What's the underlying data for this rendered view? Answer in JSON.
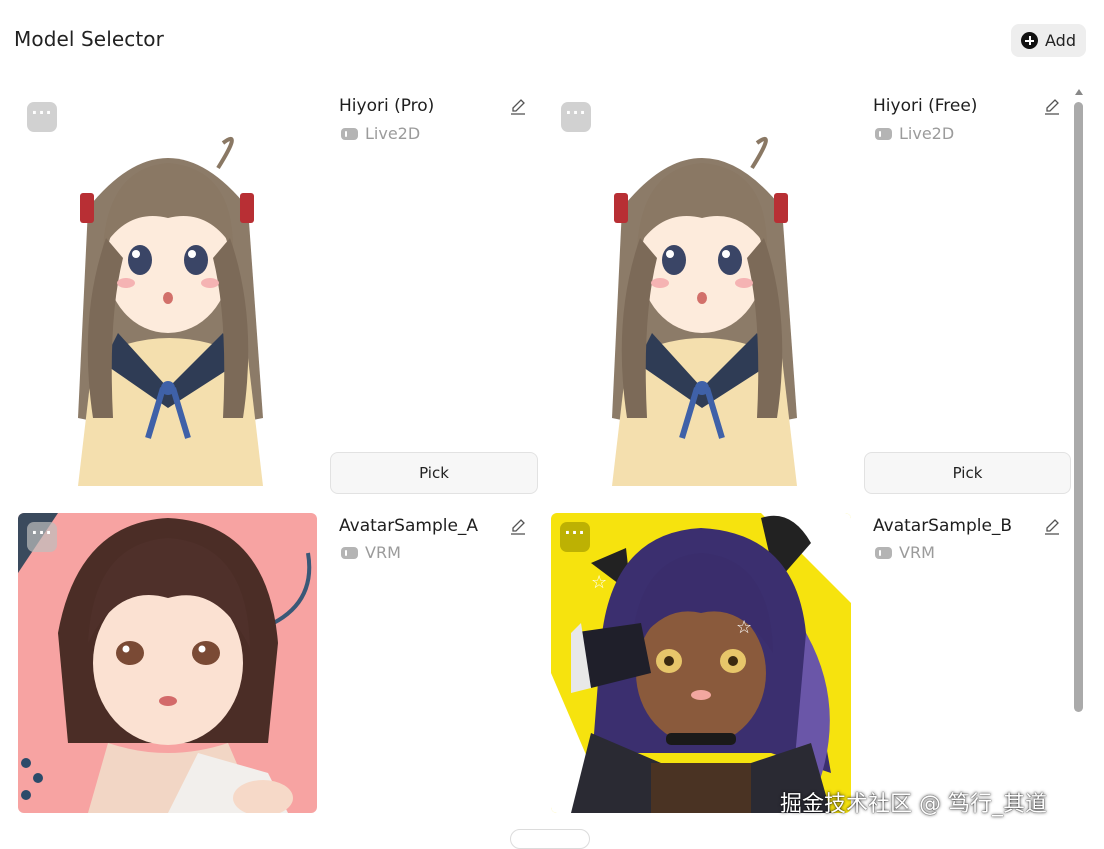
{
  "header": {
    "title": "Model Selector",
    "add_label": "Add"
  },
  "models": [
    {
      "name": "Hiyori (Pro)",
      "type": "Live2D",
      "pick_label": "Pick",
      "more_label": "···"
    },
    {
      "name": "Hiyori (Free)",
      "type": "Live2D",
      "pick_label": "Pick",
      "more_label": "···"
    },
    {
      "name": "AvatarSample_A",
      "type": "VRM",
      "more_label": "···"
    },
    {
      "name": "AvatarSample_B",
      "type": "VRM",
      "more_label": "···"
    }
  ],
  "watermark": "掘金技术社区 @ 笃行_其道",
  "colors": {
    "accent": "#111111",
    "avatar_a_bg": "#f7a3a2",
    "avatar_b_bg": "#f6e30e"
  }
}
